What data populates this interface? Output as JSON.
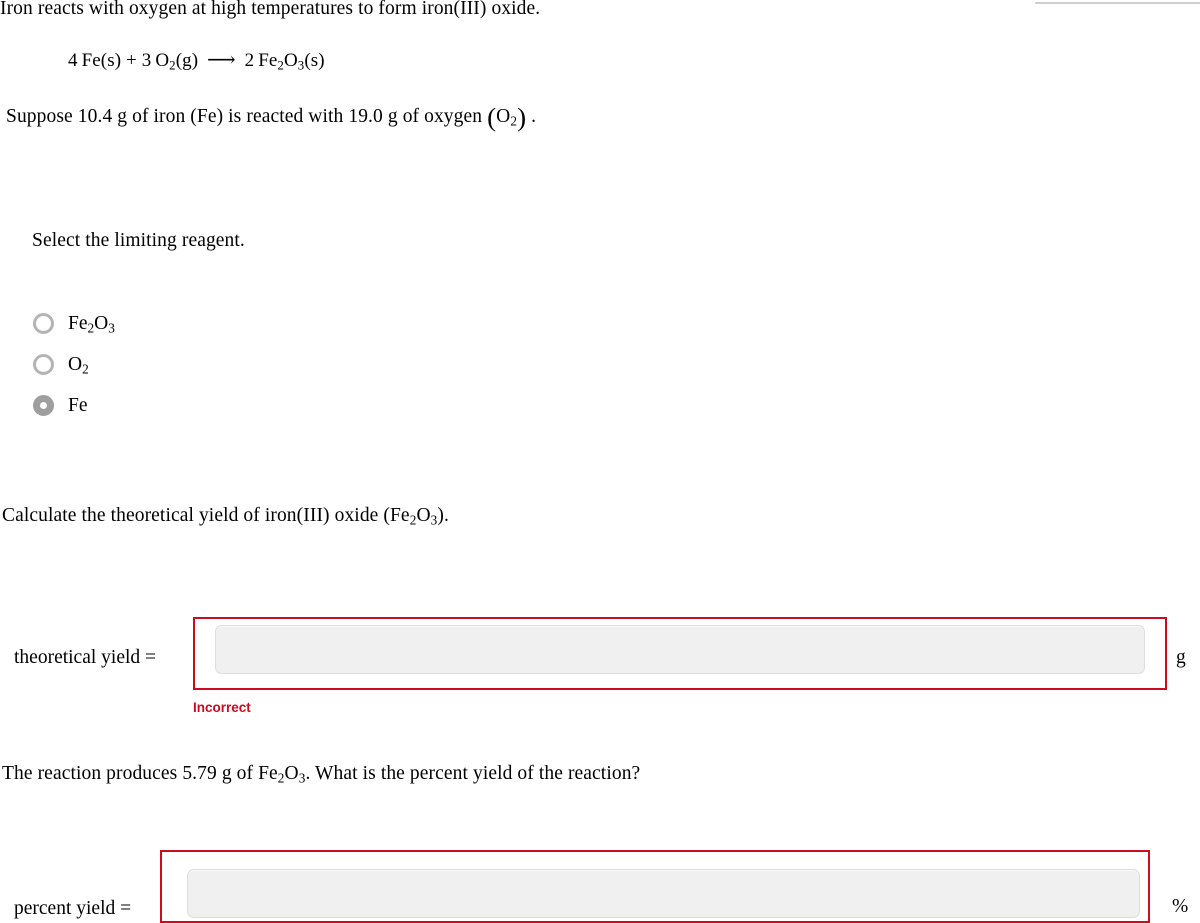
{
  "problem": {
    "intro": "Iron reacts with oxygen at high temperatures to form iron(III) oxide.",
    "equation": {
      "reactant_1_coeff": "4",
      "reactant_1": "Fe(s)",
      "plus": "+",
      "reactant_2_coeff": "3",
      "reactant_2_formula": "O",
      "reactant_2_sub": "2",
      "reactant_2_state": "(g)",
      "arrow": "⟶",
      "product_coeff": "2",
      "product_part_1": "Fe",
      "product_sub_1": "2",
      "product_part_2": "O",
      "product_sub_2": "3",
      "product_state": "(s)"
    },
    "suppose": {
      "prefix": "Suppose ",
      "iron_mass": "10.4",
      "middle": " g of iron (Fe) is reacted with ",
      "oxygen_mass": "19.0",
      "suffix": " g of oxygen ",
      "oxygen_formula": "O",
      "oxygen_sub": "2",
      "period": "."
    }
  },
  "limiting_reagent": {
    "prompt": "Select the limiting reagent.",
    "options": [
      {
        "label_part_1": "Fe",
        "sub_1": "2",
        "label_part_2": "O",
        "sub_2": "3",
        "selected": false,
        "name": "fe2o3"
      },
      {
        "label_part_1": "O",
        "sub_1": "2",
        "label_part_2": "",
        "sub_2": "",
        "selected": false,
        "name": "o2"
      },
      {
        "label_part_1": "Fe",
        "sub_1": "",
        "label_part_2": "",
        "sub_2": "",
        "selected": true,
        "name": "fe"
      }
    ]
  },
  "theoretical_yield": {
    "prompt_prefix": "Calculate the theoretical yield of iron(III) oxide (Fe",
    "prompt_sub_1": "2",
    "prompt_mid": "O",
    "prompt_sub_2": "3",
    "prompt_suffix": ").",
    "label": "theoretical yield =",
    "value": "",
    "unit": "g",
    "feedback": "Incorrect"
  },
  "percent_yield": {
    "prompt_prefix": "The reaction produces ",
    "produced_mass": "5.79",
    "prompt_mid": " g of Fe",
    "prompt_sub_1": "2",
    "prompt_mid_2": "O",
    "prompt_sub_2": "3",
    "prompt_suffix": ". What is the percent yield of the reaction?",
    "label": "percent yield =",
    "value": "",
    "unit": "%"
  },
  "colors": {
    "error_red": "#cc0a21",
    "input_fill": "#f0f0f0",
    "radio_selected": "#9e9e9e",
    "radio_border": "#b4b4b4",
    "rule_gray": "#cfcfcf"
  }
}
